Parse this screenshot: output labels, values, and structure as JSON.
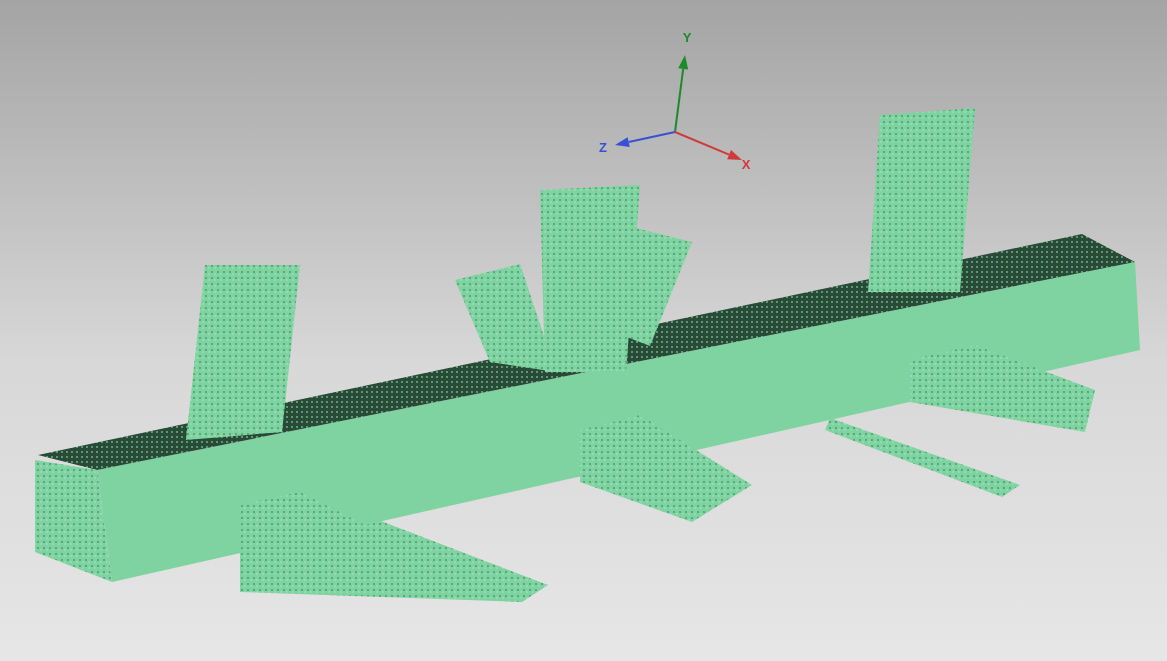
{
  "viewport": {
    "axis_gizmo": {
      "axes": [
        {
          "text": "Y",
          "color": "#1f8a2a"
        },
        {
          "text": "Z",
          "color": "#3a4fd8"
        },
        {
          "text": "X",
          "color": "#d03a3a"
        }
      ]
    }
  }
}
